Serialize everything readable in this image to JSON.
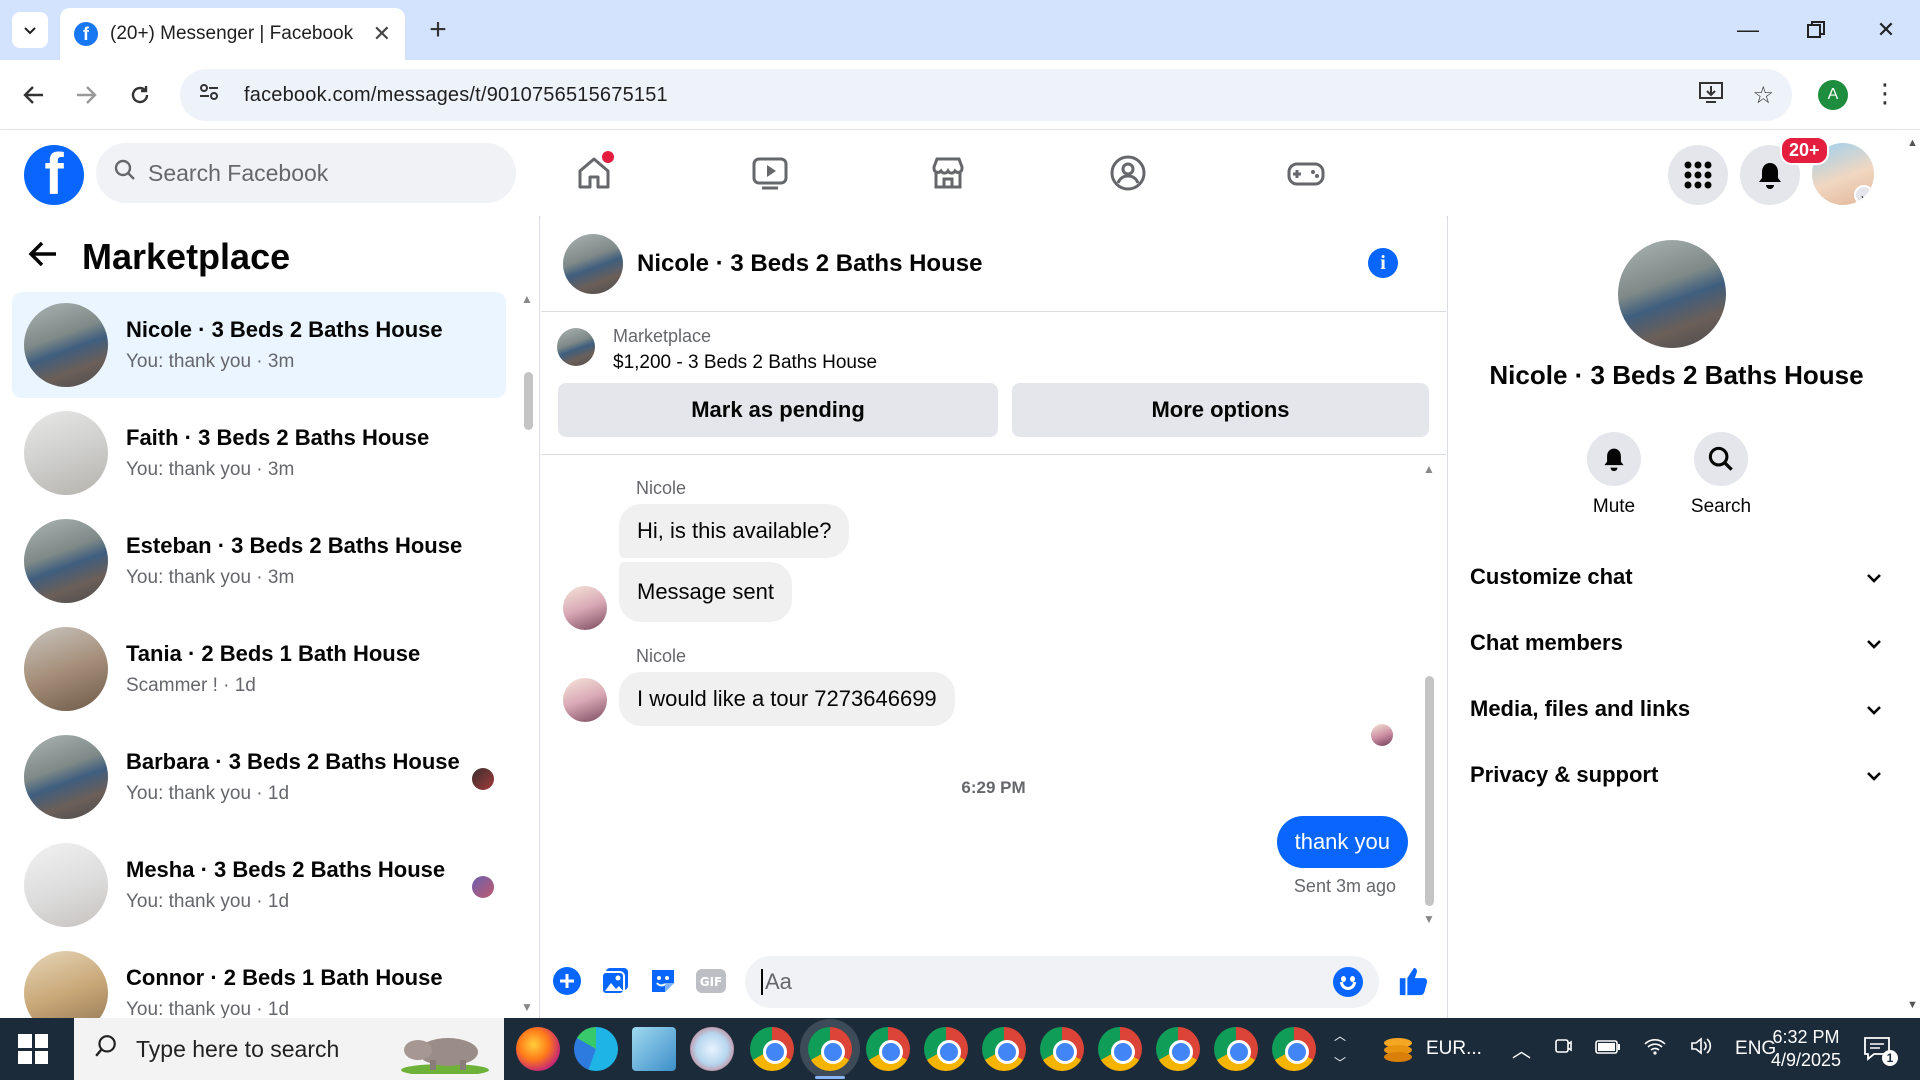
{
  "browser": {
    "tab_title": "(20+) Messenger | Facebook",
    "url": "facebook.com/messages/t/9010756515675151",
    "profile_initial": "A"
  },
  "fb": {
    "search_placeholder": "Search Facebook",
    "notif_badge": "20+"
  },
  "left": {
    "title": "Marketplace",
    "conversations": [
      {
        "title": "Nicole · 3 Beds 2 Baths House",
        "sub": "You: thank you · 3m"
      },
      {
        "title": "Faith · 3 Beds 2 Baths House",
        "sub": "You: thank you · 3m"
      },
      {
        "title": "Esteban · 3 Beds 2 Baths House",
        "sub": "You: thank you · 3m"
      },
      {
        "title": "Tania · 2 Beds 1 Bath House",
        "sub": "Scammer ! · 1d"
      },
      {
        "title": "Barbara · 3 Beds 2 Baths House",
        "sub": "You: thank you · 1d"
      },
      {
        "title": "Mesha · 3 Beds 2 Baths House",
        "sub": "You: thank you · 1d"
      },
      {
        "title": "Connor · 2 Beds 1 Bath House",
        "sub": "You: thank you · 1d"
      }
    ]
  },
  "chat": {
    "title": "Nicole · 3 Beds 2 Baths House",
    "marketplace_label": "Marketplace",
    "listing": "$1,200 - 3 Beds 2 Baths House",
    "btn_pending": "Mark as pending",
    "btn_more": "More options",
    "sender_1": "Nicole",
    "msg_1": "Hi, is this available?",
    "msg_2": "Message sent",
    "sender_2": "Nicole",
    "msg_3": "I would like a tour 7273646699",
    "timestamp": "6:29 PM",
    "msg_out": "thank you",
    "sent_status": "Sent 3m ago",
    "composer_placeholder": "Aa"
  },
  "right": {
    "title": "Nicole · 3 Beds 2 Baths House",
    "mute": "Mute",
    "search": "Search",
    "sections": [
      "Customize chat",
      "Chat members",
      "Media, files and links",
      "Privacy & support"
    ]
  },
  "taskbar": {
    "search_placeholder": "Type here to search",
    "weather": "EUR...",
    "lang": "ENG",
    "time": "6:32 PM",
    "date": "4/9/2025",
    "notif_count": "1"
  },
  "colors": {
    "accent": "#0866ff",
    "active_conv": "#ebf5ff",
    "badge": "#e41e3f"
  }
}
